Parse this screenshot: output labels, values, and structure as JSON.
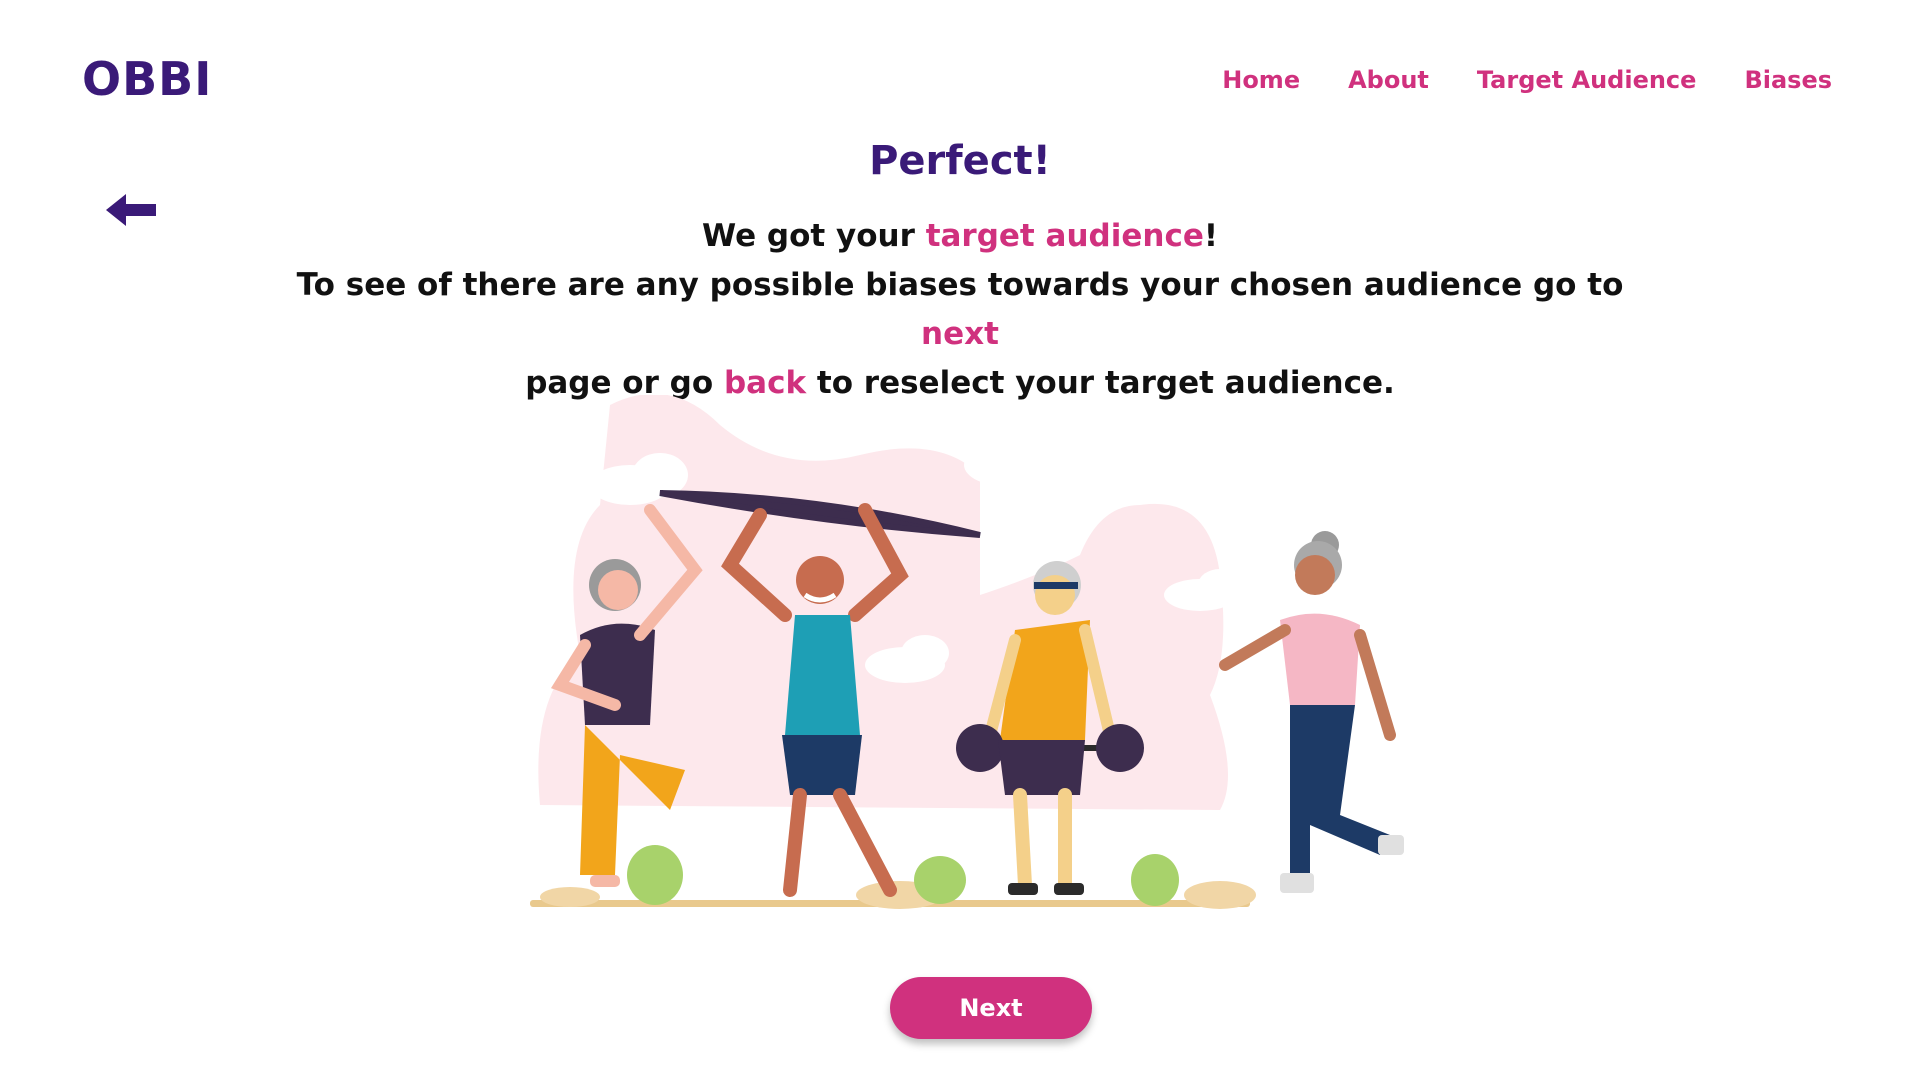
{
  "header": {
    "logo": "OBBI",
    "nav": [
      "Home",
      "About",
      "Target Audience",
      "Biases"
    ]
  },
  "main": {
    "title": "Perfect!",
    "line1_prefix": "We got your ",
    "line1_highlight": "target audience",
    "line1_suffix": "!",
    "line2_prefix": "To see of there are any possible biases towards your chosen audience go to ",
    "line2_highlight": "next",
    "line3_prefix": " page or go ",
    "line3_highlight": "back",
    "line3_suffix": " to reselect your target audience.",
    "next_label": "Next"
  },
  "colors": {
    "primary": "#3a1a78",
    "accent": "#d0317e",
    "background": "#ffffff",
    "illustration_bg": "#fde8ec"
  },
  "icons": {
    "back": "arrow-left-icon"
  }
}
